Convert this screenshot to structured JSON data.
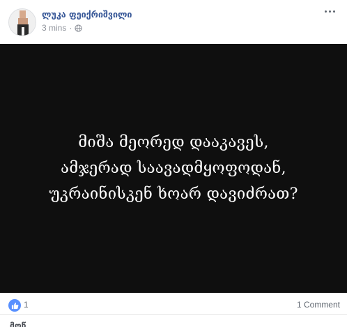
{
  "post": {
    "author": "ლუკა ფეიქრიშვილი",
    "timestamp": "3 mins",
    "separator": "·",
    "privacy_icon": "globe-icon",
    "image_text_lines": [
      "მიშა მეორედ დააკავეს,",
      "ამჯერად საავადმყოფოდან,",
      "უკრაინისკენ ხოარ დავიძრათ?"
    ]
  },
  "stats": {
    "like_icon": "thumbs-up-icon",
    "like_count": "1",
    "comment_count": "1 Comment"
  },
  "actions": {
    "like_label": "მოწ"
  },
  "colors": {
    "author_link": "#385898",
    "image_background": "#0f0f0f",
    "like_badge": "#5890ff"
  }
}
